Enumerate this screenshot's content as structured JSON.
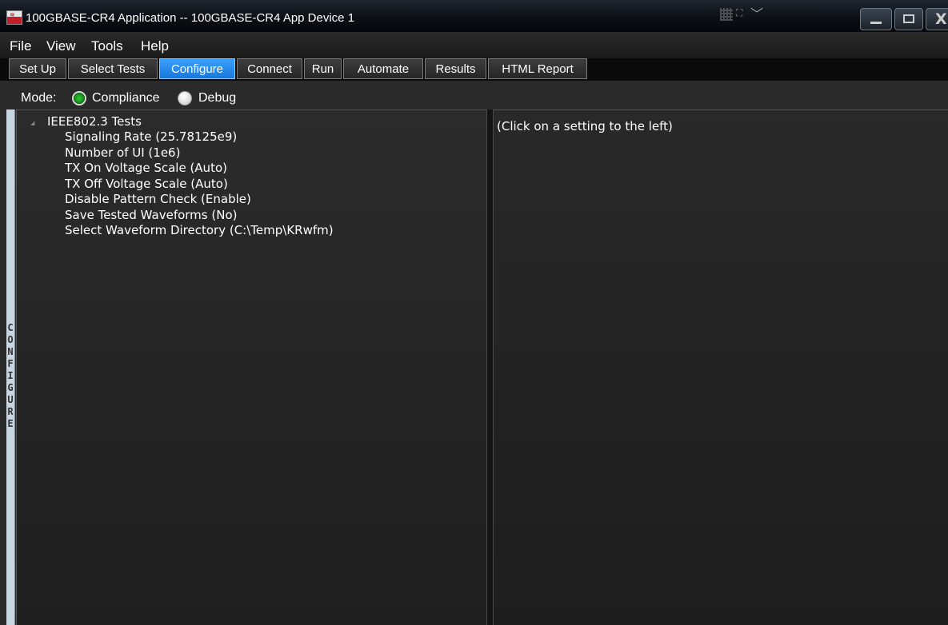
{
  "window": {
    "title": "100GBASE-CR4 Application -- 100GBASE-CR4 App Device 1",
    "app_icon": "app-logo-icon",
    "controls": [
      "grid-icon",
      "expand-icon",
      "chevron-down-icon",
      "minimize-icon",
      "maximize-icon",
      "close-icon"
    ]
  },
  "menu": {
    "items": [
      "File",
      "View",
      "Tools",
      "Help"
    ]
  },
  "tabs": {
    "items": [
      "Set Up",
      "Select Tests",
      "Configure",
      "Connect",
      "Run",
      "Automate",
      "Results",
      "HTML Report"
    ],
    "active": "Configure",
    "active_color": "#1e88e5"
  },
  "side_panel": {
    "label": "CONFIGURE"
  },
  "mode": {
    "label": "Mode:",
    "options": [
      {
        "label": "Compliance",
        "selected": true
      },
      {
        "label": "Debug",
        "selected": false
      }
    ]
  },
  "tree": {
    "root": "IEEE802.3 Tests",
    "items": [
      "Signaling Rate (25.78125e9)",
      "Number of UI (1e6)",
      "TX On Voltage Scale (Auto)",
      "TX Off Voltage Scale (Auto)",
      "Disable Pattern Check (Enable)",
      "Save Tested Waveforms (No)",
      "Select Waveform Directory (C:\\Temp\\KRwfm)"
    ]
  },
  "details": {
    "hint": "(Click on a setting to the left)"
  }
}
